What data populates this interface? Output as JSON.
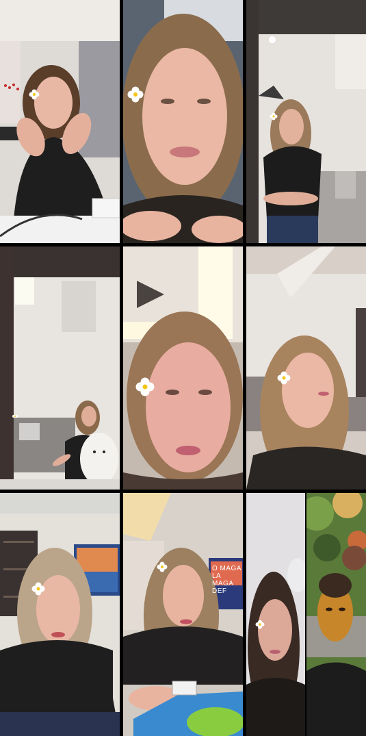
{
  "layout": "3x3 video call grid",
  "tiles": [
    {
      "id": "tile-1",
      "label": "participant-woman-touching-face"
    },
    {
      "id": "tile-2",
      "label": "participant-woman-closeup"
    },
    {
      "id": "tile-3",
      "label": "participant-woman-standing-arms-crossed"
    },
    {
      "id": "tile-4",
      "label": "participant-woman-with-plush-toy"
    },
    {
      "id": "tile-5",
      "label": "participant-woman-under-ceiling-light"
    },
    {
      "id": "tile-6",
      "label": "participant-woman-in-living-room"
    },
    {
      "id": "tile-7",
      "label": "participant-woman-leaning-forward"
    },
    {
      "id": "tile-8",
      "label": "participant-woman-with-game-controller"
    },
    {
      "id": "tile-9a",
      "label": "participant-woman-dim-room"
    },
    {
      "id": "tile-9b",
      "label": "participant-man-outdoors"
    }
  ],
  "tv_screen_text": {
    "line1": "O MAGA LA",
    "line2": "MAGA DEF"
  },
  "colors": {
    "background": "#000000",
    "skin": "#e8b8a8",
    "hair": "#8a6a4a",
    "shirt": "#1e1e1e",
    "wall": "#e8e4e0",
    "flower_petal": "#ffffff",
    "flower_center": "#f5c518"
  }
}
